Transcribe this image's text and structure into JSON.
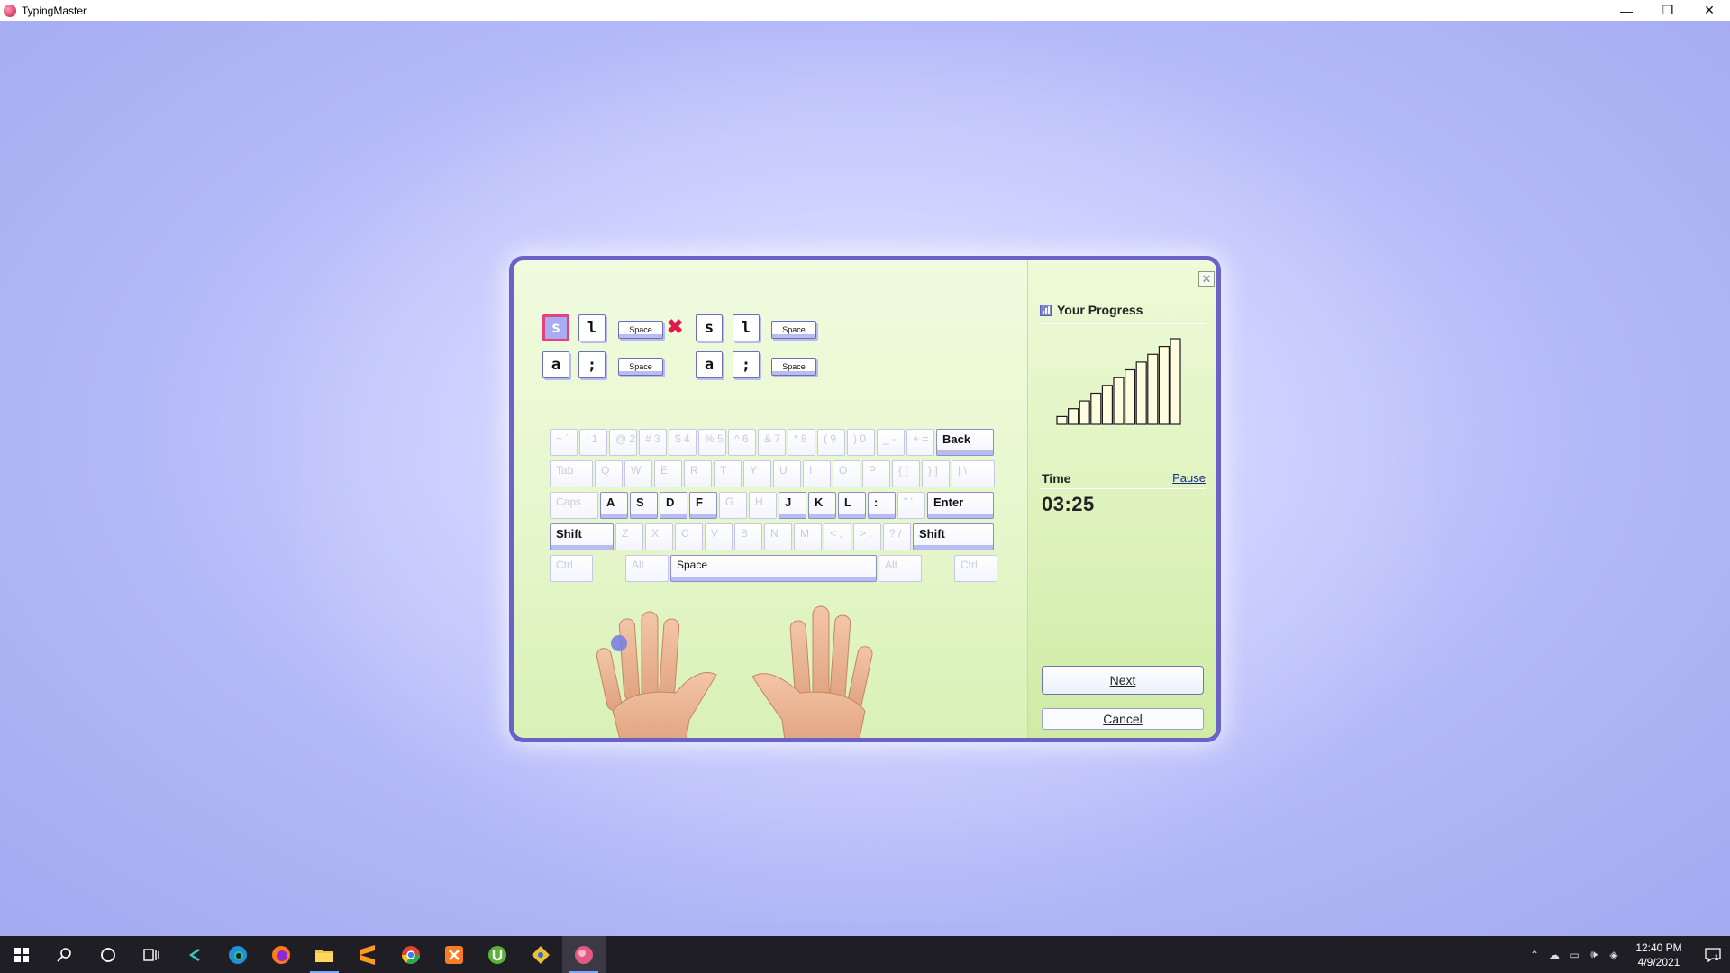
{
  "window": {
    "title": "TypingMaster",
    "minimize_glyph": "—",
    "restore_glyph": "❐",
    "close_glyph": "✕"
  },
  "exercise": {
    "row1": [
      {
        "label": "s",
        "state": "current"
      },
      {
        "label": "l",
        "state": "normal"
      },
      {
        "label": "Space",
        "state": "normal"
      },
      {
        "label": "s",
        "state": "normal"
      },
      {
        "label": "l",
        "state": "normal"
      },
      {
        "label": "Space",
        "state": "normal"
      }
    ],
    "row2": [
      {
        "label": "a"
      },
      {
        "label": ";"
      },
      {
        "label": "Space"
      },
      {
        "label": "a"
      },
      {
        "label": ";"
      },
      {
        "label": "Space"
      }
    ],
    "error_glyph": "✖"
  },
  "keyboard": {
    "row0": [
      "~ `",
      "! 1",
      "@ 2",
      "# 3",
      "$ 4",
      "% 5",
      "^ 6",
      "& 7",
      "* 8",
      "( 9",
      ") 0",
      "_ -",
      "+ =",
      "Back"
    ],
    "row1": [
      "Tab",
      "Q",
      "W",
      "E",
      "R",
      "T",
      "Y",
      "U",
      "I",
      "O",
      "P",
      "{ [",
      "} ]",
      "| \\"
    ],
    "row2": [
      "Caps",
      "A",
      "S",
      "D",
      "F",
      "G",
      "H",
      "J",
      "K",
      "L",
      ":",
      "\" '",
      "Enter"
    ],
    "row3": [
      "Shift",
      "Z",
      "X",
      "C",
      "V",
      "B",
      "N",
      "M",
      "< ,",
      "> .",
      "? /",
      "Shift"
    ],
    "row4": [
      "Ctrl",
      "Alt",
      "Space",
      "Alt",
      "Ctrl"
    ],
    "active_keys": [
      "Back",
      "A",
      "S",
      "D",
      "F",
      "J",
      "K",
      "L",
      ":",
      "Enter",
      "Shift",
      "Space"
    ]
  },
  "progress": {
    "title": "Your Progress",
    "bars": [
      1,
      2,
      3,
      4,
      5,
      6,
      7,
      8,
      9,
      10,
      11
    ]
  },
  "timer": {
    "label": "Time",
    "pause_label": "Pause",
    "value": "03:25"
  },
  "buttons": {
    "next": "Next",
    "cancel": "Cancel",
    "close_glyph": "✕"
  },
  "taskbar": {
    "apps": [
      "start",
      "search",
      "cortana",
      "task-view",
      "vscode",
      "edge",
      "firefox",
      "file-explorer",
      "sublime",
      "chrome",
      "xampp",
      "utorrent",
      "git",
      "typingmaster"
    ],
    "time": "12:40 PM",
    "date": "4/9/2021",
    "notification_count": "1"
  }
}
